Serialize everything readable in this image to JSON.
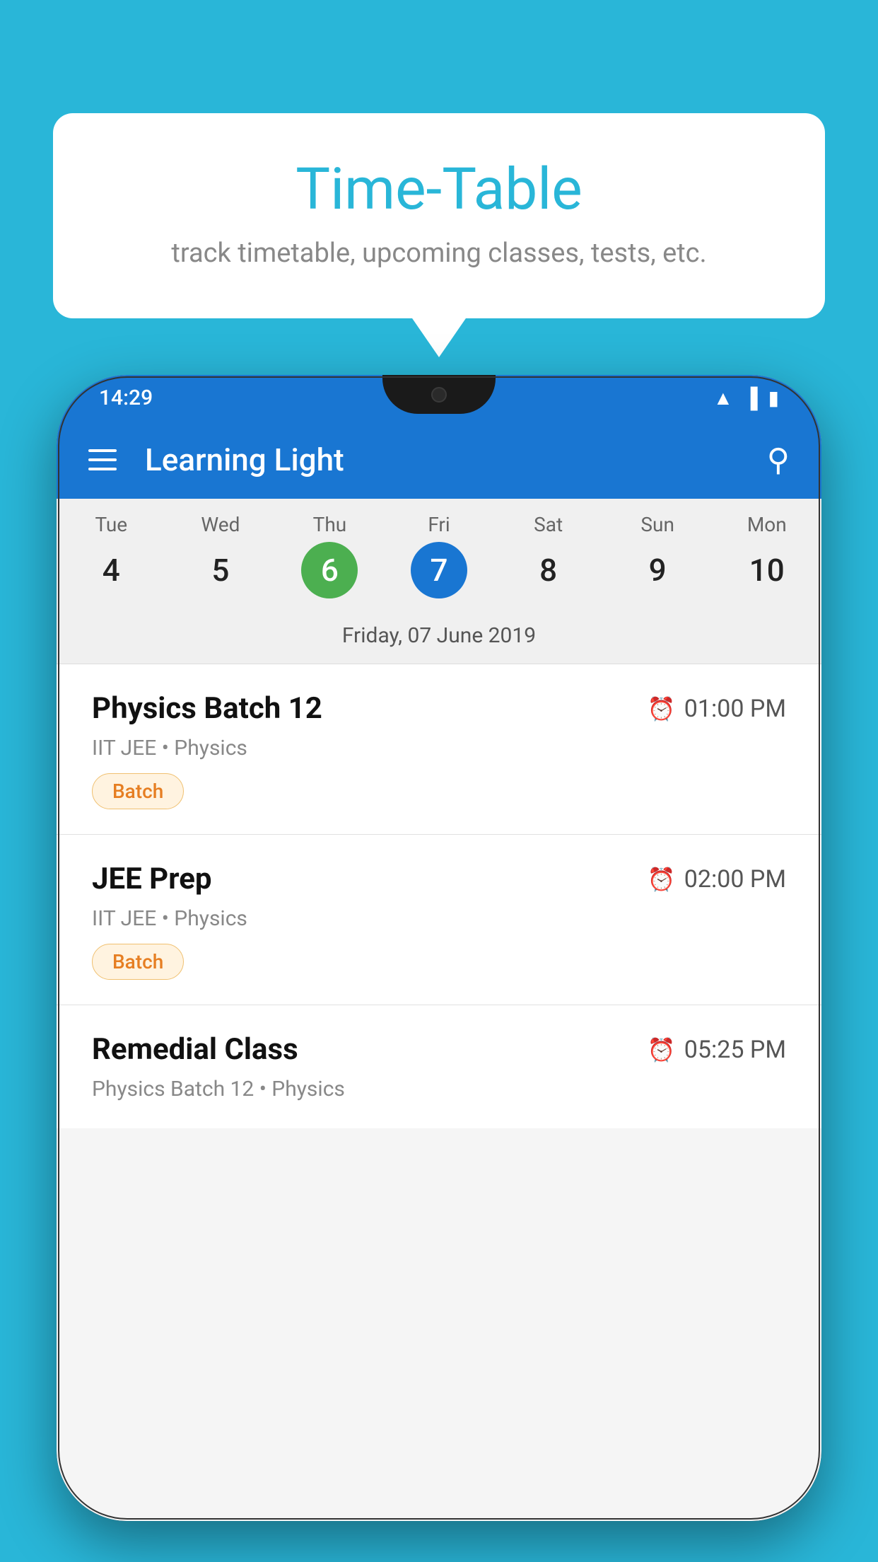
{
  "background_color": "#29b6d8",
  "bubble": {
    "title": "Time-Table",
    "subtitle": "track timetable, upcoming classes, tests, etc."
  },
  "phone": {
    "status_bar": {
      "time": "14:29",
      "icons": [
        "wifi",
        "signal",
        "battery"
      ]
    },
    "app_bar": {
      "title": "Learning Light",
      "search_label": "Search"
    },
    "calendar": {
      "days": [
        {
          "name": "Tue",
          "number": "4",
          "state": "normal"
        },
        {
          "name": "Wed",
          "number": "5",
          "state": "normal"
        },
        {
          "name": "Thu",
          "number": "6",
          "state": "today"
        },
        {
          "name": "Fri",
          "number": "7",
          "state": "selected"
        },
        {
          "name": "Sat",
          "number": "8",
          "state": "normal"
        },
        {
          "name": "Sun",
          "number": "9",
          "state": "normal"
        },
        {
          "name": "Mon",
          "number": "10",
          "state": "normal"
        }
      ],
      "selected_date_label": "Friday, 07 June 2019"
    },
    "schedule": [
      {
        "title": "Physics Batch 12",
        "time": "01:00 PM",
        "subtitle": "IIT JEE • Physics",
        "badge": "Batch"
      },
      {
        "title": "JEE Prep",
        "time": "02:00 PM",
        "subtitle": "IIT JEE • Physics",
        "badge": "Batch"
      },
      {
        "title": "Remedial Class",
        "time": "05:25 PM",
        "subtitle": "Physics Batch 12 • Physics",
        "badge": ""
      }
    ]
  }
}
